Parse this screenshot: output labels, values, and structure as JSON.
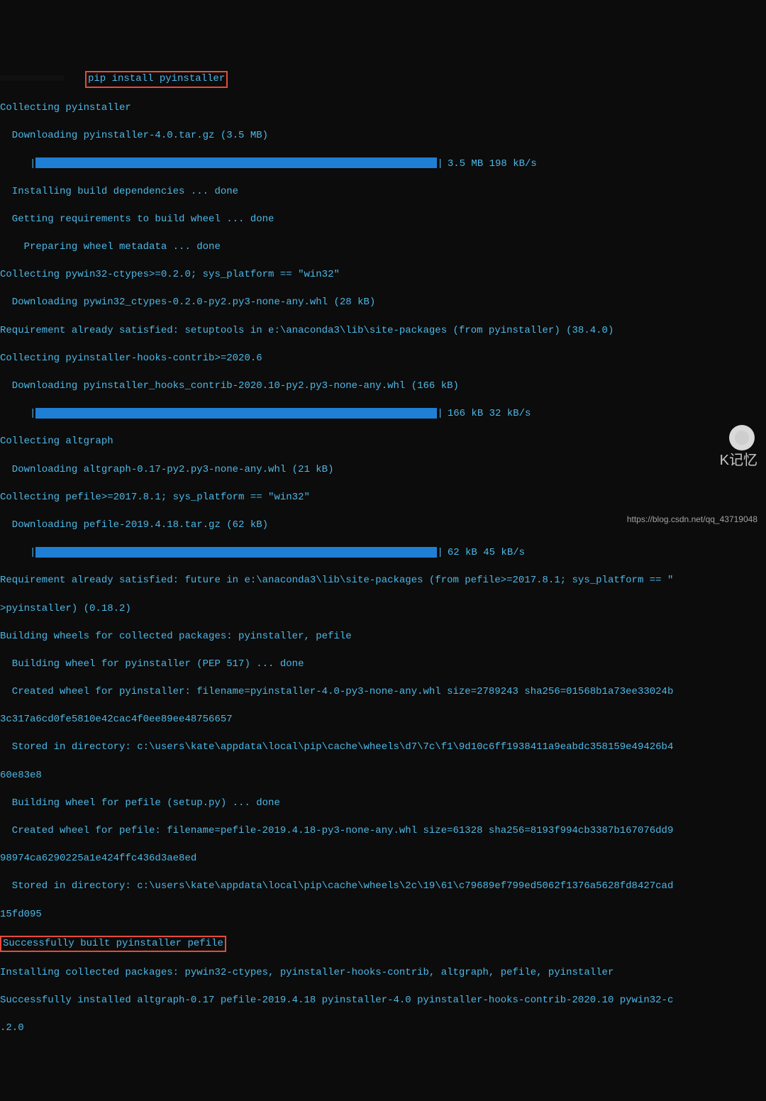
{
  "command": "pip install pyinstaller",
  "lines": {
    "collect1": "Collecting pyinstaller",
    "dl1": "  Downloading pyinstaller-4.0.tar.gz (3.5 MB)",
    "bar1_text": "3.5 MB 198 kB/s",
    "build_deps": "  Installing build dependencies ... done",
    "get_req": "  Getting requirements to build wheel ... done",
    "prep_meta": "    Preparing wheel metadata ... done",
    "collect2": "Collecting pywin32-ctypes>=0.2.0; sys_platform == \"win32\"",
    "dl2": "  Downloading pywin32_ctypes-0.2.0-py2.py3-none-any.whl (28 kB)",
    "req_sat1": "Requirement already satisfied: setuptools in e:\\anaconda3\\lib\\site-packages (from pyinstaller) (38.4.0)",
    "collect3": "Collecting pyinstaller-hooks-contrib>=2020.6",
    "dl3": "  Downloading pyinstaller_hooks_contrib-2020.10-py2.py3-none-any.whl (166 kB)",
    "bar2_text": "166 kB 32 kB/s",
    "collect4": "Collecting altgraph",
    "dl4": "  Downloading altgraph-0.17-py2.py3-none-any.whl (21 kB)",
    "collect5": "Collecting pefile>=2017.8.1; sys_platform == \"win32\"",
    "dl5": "  Downloading pefile-2019.4.18.tar.gz (62 kB)",
    "bar3_text": "62 kB 45 kB/s",
    "req_sat2a": "Requirement already satisfied: future in e:\\anaconda3\\lib\\site-packages (from pefile>=2017.8.1; sys_platform == \"",
    "req_sat2b": ">pyinstaller) (0.18.2)",
    "build_wheels": "Building wheels for collected packages: pyinstaller, pefile",
    "bw1": "  Building wheel for pyinstaller (PEP 517) ... done",
    "cw1a": "  Created wheel for pyinstaller: filename=pyinstaller-4.0-py3-none-any.whl size=2789243 sha256=01568b1a73ee33024b",
    "cw1b": "3c317a6cd0fe5810e42cac4f0ee89ee48756657",
    "sd1a": "  Stored in directory: c:\\users\\kate\\appdata\\local\\pip\\cache\\wheels\\d7\\7c\\f1\\9d10c6ff1938411a9eabdc358159e49426b4",
    "sd1b": "60e83e8",
    "bw2": "  Building wheel for pefile (setup.py) ... done",
    "cw2a": "  Created wheel for pefile: filename=pefile-2019.4.18-py3-none-any.whl size=61328 sha256=8193f994cb3387b167076dd9",
    "cw2b": "98974ca6290225a1e424ffc436d3ae8ed",
    "sd2a": "  Stored in directory: c:\\users\\kate\\appdata\\local\\pip\\cache\\wheels\\2c\\19\\61\\c79689ef799ed5062f1376a5628fd8427cad",
    "sd2b": "15fd095",
    "success_build": "Successfully built pyinstaller pefile",
    "install_coll": "Installing collected packages: pywin32-ctypes, pyinstaller-hooks-contrib, altgraph, pefile, pyinstaller",
    "success_inst_a": "Successfully installed altgraph-0.17 pefile-2019.4.18 pyinstaller-4.0 pyinstaller-hooks-contrib-2020.10 pywin32-c",
    "success_inst_b": ".2.0"
  },
  "watermark": {
    "name": "K记忆",
    "url": "https://blog.csdn.net/qq_43719048"
  }
}
